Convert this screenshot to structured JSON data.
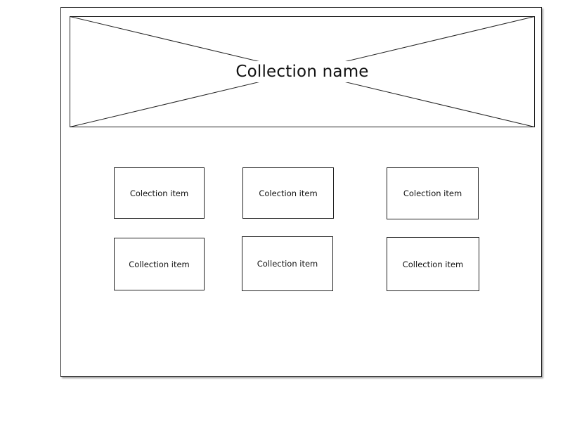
{
  "collection": {
    "name": "Collection name"
  },
  "items": [
    {
      "label": "Colection item"
    },
    {
      "label": "Colection item"
    },
    {
      "label": "Colection item"
    },
    {
      "label": "Collection item"
    },
    {
      "label": "Collection item"
    },
    {
      "label": "Collection item"
    }
  ]
}
